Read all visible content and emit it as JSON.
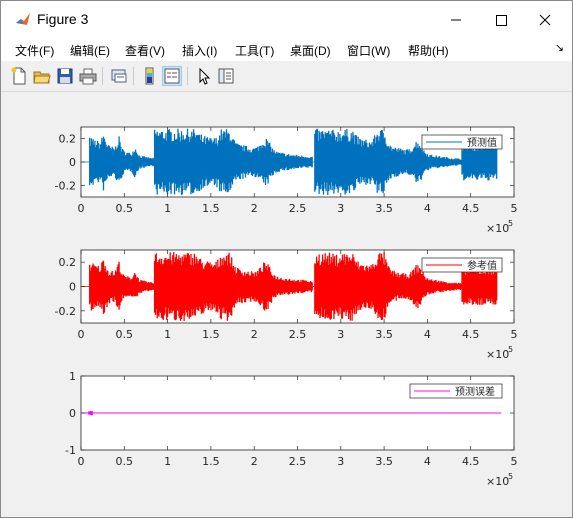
{
  "window": {
    "title": "Figure 3"
  },
  "menu": [
    "文件(F)",
    "编辑(E)",
    "查看(V)",
    "插入(I)",
    "工具(T)",
    "桌面(D)",
    "窗口(W)",
    "帮助(H)"
  ],
  "toolbar": [
    "new-figure-icon",
    "open-icon",
    "save-icon",
    "print-icon",
    "link-icon",
    "colorbar-icon",
    "legend-icon",
    "pointer-icon",
    "property-editor-icon"
  ],
  "chart_data": [
    {
      "type": "line",
      "legend": "预测值",
      "legend_placement": "top-right",
      "color": "#0072bd",
      "xlim": [
        0,
        500000
      ],
      "ylim": [
        -0.3,
        0.3
      ],
      "xticks": [
        "0",
        "0.5",
        "1",
        "1.5",
        "2",
        "2.5",
        "3",
        "3.5",
        "4",
        "4.5",
        "5"
      ],
      "yticks": [
        "0.2",
        "0",
        "-0.2"
      ],
      "x_exponent_base": "×10",
      "x_exponent": "5",
      "x_data_end": 480000
    },
    {
      "type": "line",
      "legend": "参考值",
      "legend_placement": "top-right",
      "color": "#ff0000",
      "xlim": [
        0,
        500000
      ],
      "ylim": [
        -0.3,
        0.3
      ],
      "xticks": [
        "0",
        "0.5",
        "1",
        "1.5",
        "2",
        "2.5",
        "3",
        "3.5",
        "4",
        "4.5",
        "5"
      ],
      "yticks": [
        "0.2",
        "0",
        "-0.2"
      ],
      "x_exponent_base": "×10",
      "x_exponent": "5",
      "x_data_end": 480000
    },
    {
      "type": "line",
      "legend": "预测误差",
      "legend_placement": "top-right",
      "color": "#ff00ff",
      "xlim": [
        0,
        500000
      ],
      "ylim": [
        -1,
        1
      ],
      "xticks": [
        "0",
        "0.5",
        "1",
        "1.5",
        "2",
        "2.5",
        "3",
        "3.5",
        "4",
        "4.5",
        "5"
      ],
      "yticks": [
        "1",
        "0",
        "-1"
      ],
      "x_exponent_base": "×10",
      "x_exponent": "5",
      "x_data_end": 485000
    }
  ]
}
